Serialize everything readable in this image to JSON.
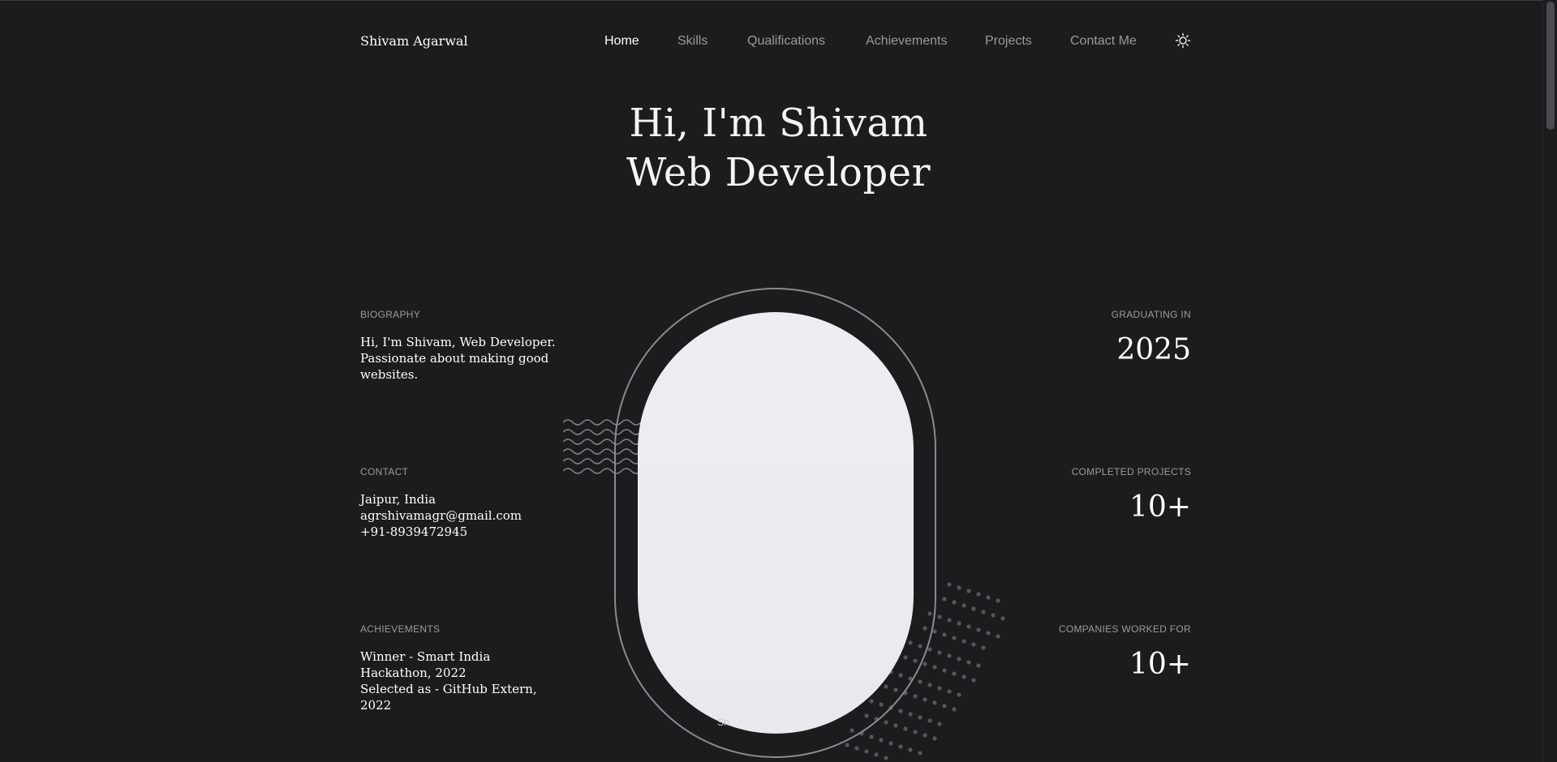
{
  "header": {
    "brand": "Shivam Agarwal",
    "nav": [
      {
        "label": "Home",
        "active": true
      },
      {
        "label": "Skills",
        "active": false
      },
      {
        "label": "Qualifications",
        "active": false
      },
      {
        "label": "Achievements",
        "active": false
      },
      {
        "label": "Projects",
        "active": false
      },
      {
        "label": "Contact Me",
        "active": false
      }
    ],
    "theme_toggle_icon": "sun-icon"
  },
  "hero": {
    "line1": "Hi, I'm Shivam",
    "line2": "Web Developer"
  },
  "left": {
    "biography": {
      "label": "BIOGRAPHY",
      "lines": [
        "Hi, I'm Shivam, Web Developer.",
        "Passionate about making good",
        "websites."
      ]
    },
    "contact": {
      "label": "CONTACT",
      "location": "Jaipur, India",
      "email": "agrshivamagr@gmail.com",
      "phone": "+91-8939472945"
    },
    "achievements": {
      "label": "ACHIEVEMENTS",
      "lines": [
        "Winner - Smart India",
        "Hackathon, 2022",
        "Selected as - GitHub Extern,",
        "2022"
      ]
    }
  },
  "right": {
    "graduating": {
      "label": "GRADUATING IN",
      "value": "2025"
    },
    "projects": {
      "label": "COMPLETED PROJECTS",
      "value": "10+"
    },
    "companies": {
      "label": "COMPANIES WORKED FOR",
      "value": "10+"
    }
  },
  "portrait": {
    "caption": "Sh"
  },
  "colors": {
    "background": "#1b1c1e",
    "text": "#ffffff",
    "muted": "#9a9a9a",
    "portrait_bg": "#eceef2"
  }
}
